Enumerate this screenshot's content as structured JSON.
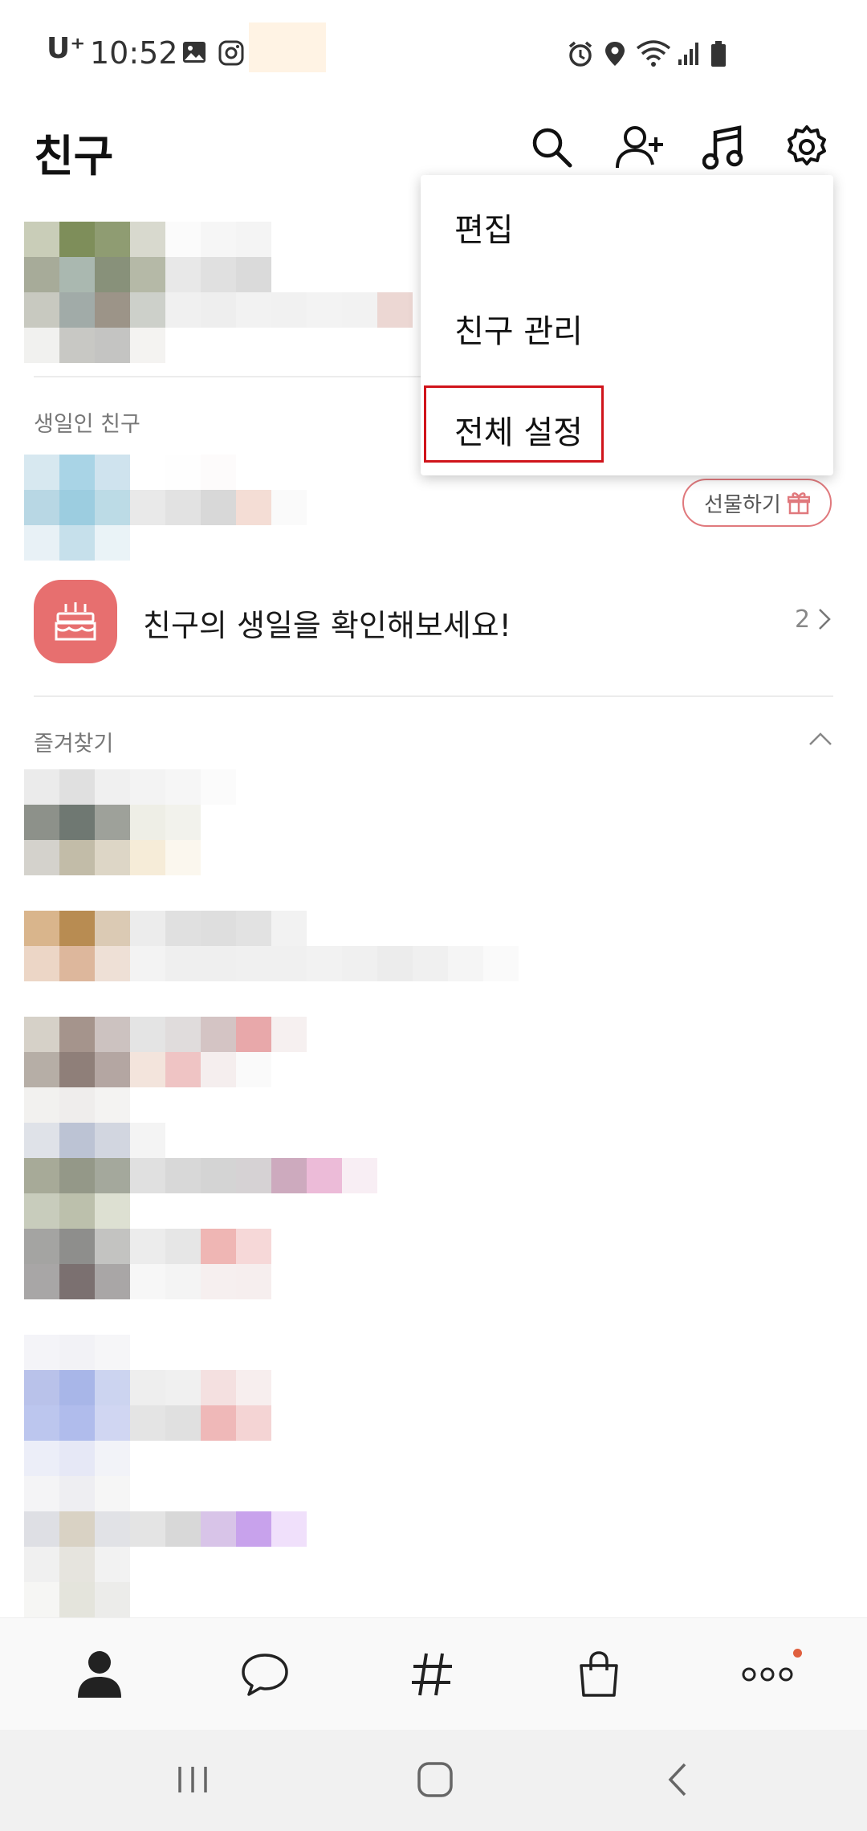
{
  "status_bar": {
    "carrier": "U⁺",
    "time": "10:52",
    "icons": [
      "gallery-icon",
      "instagram-icon",
      "alarm-icon",
      "location-icon",
      "wifi-icon",
      "signal-icon",
      "battery-icon"
    ]
  },
  "header": {
    "title": "친구",
    "actions": [
      "search-icon",
      "add-friend-icon",
      "music-icon",
      "settings-icon"
    ]
  },
  "menu": {
    "items": [
      {
        "label": "편집"
      },
      {
        "label": "친구 관리"
      },
      {
        "label": "전체 설정",
        "highlighted": true
      }
    ],
    "highlight_color": "#d0141b"
  },
  "birthday_section": {
    "label": "생일인 친구",
    "gift_button": "선물하기",
    "banner_text": "친구의 생일을 확인해보세요!",
    "count": "2"
  },
  "favorites": {
    "label": "즐겨찾기"
  },
  "bottom_nav": {
    "items": [
      "friends-icon",
      "chat-icon",
      "hashtag-icon",
      "shopping-icon",
      "more-icon"
    ],
    "active": "friends-icon"
  },
  "colors": {
    "accent": "#e76f6f",
    "alert": "#d0141b",
    "notification": "#e0603f"
  }
}
